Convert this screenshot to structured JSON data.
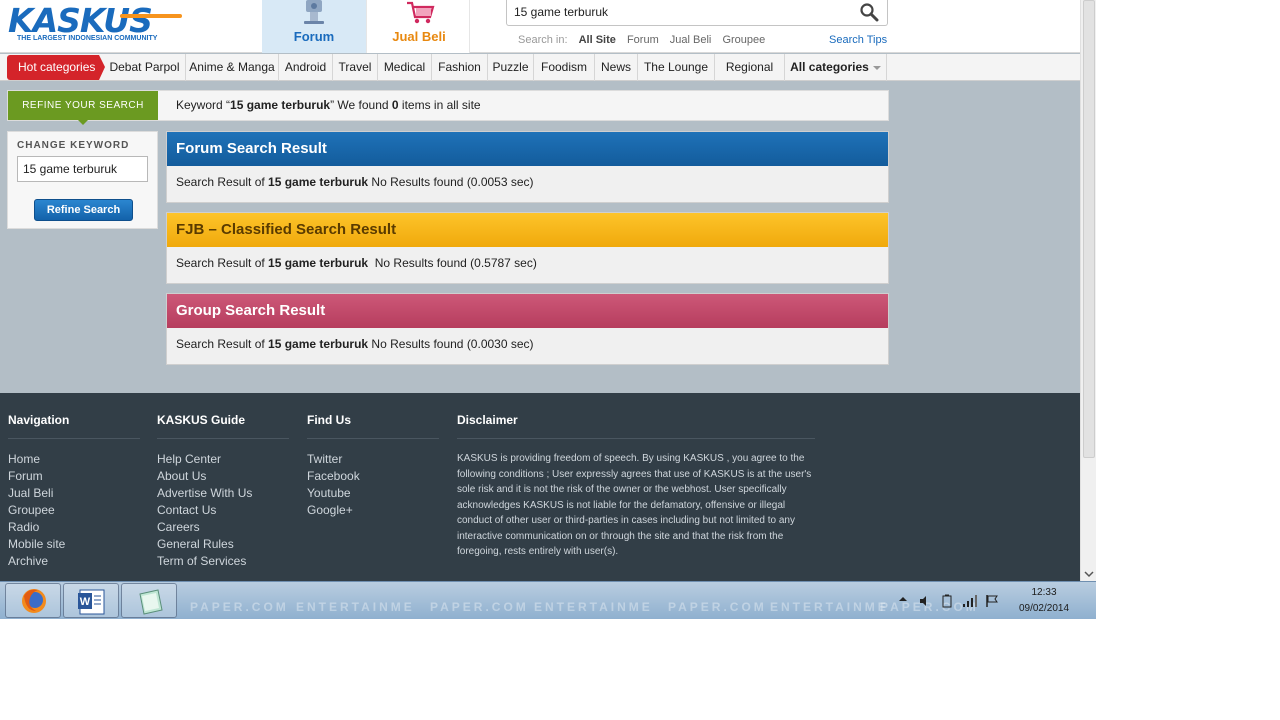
{
  "header": {
    "logo_text": "KASKUS",
    "logo_tagline": "THE LARGEST INDONESIAN COMMUNITY",
    "tabs": [
      {
        "label": "Forum",
        "icon": "forum-icon",
        "active": true
      },
      {
        "label": "Jual Beli",
        "icon": "shopping-cart-icon",
        "active": false
      }
    ],
    "search": {
      "value": "15 game terburuk",
      "search_in_label": "Search in:",
      "options": [
        "All Site",
        "Forum",
        "Jual Beli",
        "Groupee"
      ],
      "selected": "All Site",
      "tips": "Search Tips"
    }
  },
  "categories": {
    "hot": "Hot categories",
    "items": [
      "Debat Parpol",
      "Anime & Manga",
      "Android",
      "Travel",
      "Medical",
      "Fashion",
      "Puzzle",
      "Foodism",
      "News",
      "The Lounge",
      "Regional"
    ],
    "all": "All categories"
  },
  "refine": {
    "label": "REFINE YOUR SEARCH",
    "keyword_prefix": "Keyword “",
    "keyword": "15 game terburuk",
    "keyword_mid": "” We found ",
    "count": "0",
    "keyword_suffix": " items in all site"
  },
  "change_keyword": {
    "title": "CHANGE KEYWORD",
    "value": "15 game terburuk",
    "button": "Refine Search"
  },
  "results": [
    {
      "title": "Forum Search Result",
      "prefix": "Search Result of ",
      "keyword": "15 game terburuk",
      "status": " No Results found (0.0053 sec)"
    },
    {
      "title": "FJB – Classified Search Result",
      "prefix": "Search Result of ",
      "keyword": "15 game terburuk",
      "status": "  No Results found (0.5787 sec)"
    },
    {
      "title": "Group Search Result",
      "prefix": "Search Result of ",
      "keyword": "15 game terburuk",
      "status": " No Results found (0.0030 sec)"
    }
  ],
  "footer": {
    "navigation": {
      "title": "Navigation",
      "links": [
        "Home",
        "Forum",
        "Jual Beli",
        "Groupee",
        "Radio",
        "Mobile site",
        "Archive"
      ]
    },
    "guide": {
      "title": "KASKUS Guide",
      "links": [
        "Help Center",
        "About Us",
        "Advertise With Us",
        "Contact Us",
        "Careers",
        "General Rules",
        "Term of Services"
      ]
    },
    "find_us": {
      "title": "Find Us",
      "links": [
        "Twitter",
        "Facebook",
        "Youtube",
        "Google+"
      ]
    },
    "disclaimer": {
      "title": "Disclaimer",
      "text": "KASKUS is providing freedom of speech. By using KASKUS , you agree to the following conditions ; User expressly agrees that use of KASKUS is at the user's sole risk and it is not the risk of the owner or the webhost. User specifically acknowledges KASKUS is not liable for the defamatory, offensive or illegal conduct of other user or third-parties in cases including but not limited to any interactive communication on or through the site and that the risk from the foregoing, rests entirely with user(s)."
    }
  },
  "taskbar": {
    "apps": [
      "firefox-icon",
      "word-icon",
      "notes-icon"
    ],
    "watermark": [
      "PAPER.COM",
      "ENTERTAINME",
      "PAPER.COM",
      "ENTERTAINME",
      "PAPER.COM",
      "ENTERTAINME",
      "PAPER.COM"
    ],
    "clock_time": "12:33",
    "clock_date": "09/02/2014"
  },
  "colors": {
    "brand_blue": "#1a6bbd",
    "hot_red": "#d4242a",
    "refine_green": "#6b9a21",
    "forum_blue": "#135c9c",
    "fjb_yellow": "#f0a90c",
    "group_pink": "#b63d5e",
    "footer_bg": "#323e47"
  }
}
